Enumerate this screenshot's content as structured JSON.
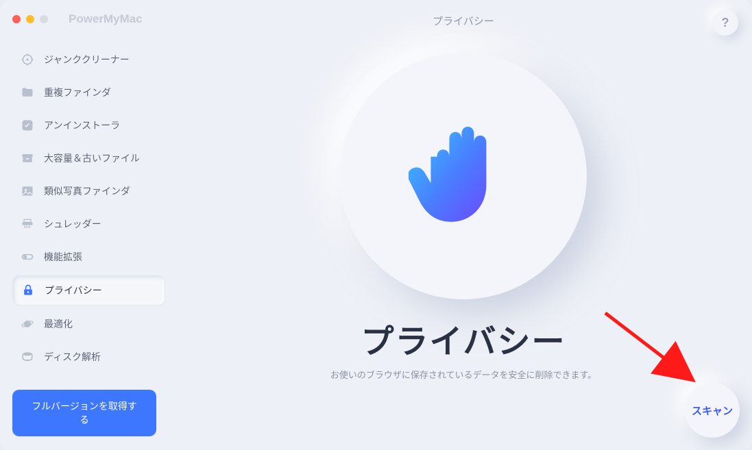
{
  "app": {
    "title": "PowerMyMac"
  },
  "header": {
    "page_title": "プライバシー",
    "help_label": "?"
  },
  "sidebar": {
    "items": [
      {
        "label": "ジャンククリーナー"
      },
      {
        "label": "重複ファインダ"
      },
      {
        "label": "アンインストーラ"
      },
      {
        "label": "大容量＆古いファイル"
      },
      {
        "label": "類似写真ファインダ"
      },
      {
        "label": "シュレッダー"
      },
      {
        "label": "機能拡張"
      },
      {
        "label": "プライバシー"
      },
      {
        "label": "最適化"
      },
      {
        "label": "ディスク解析"
      }
    ],
    "full_version_label": "フルバージョンを取得する"
  },
  "main": {
    "heading": "プライバシー",
    "subtitle": "お使いのブラウザに保存されているデータを安全に削除できます。",
    "scan_label": "スキャン"
  }
}
